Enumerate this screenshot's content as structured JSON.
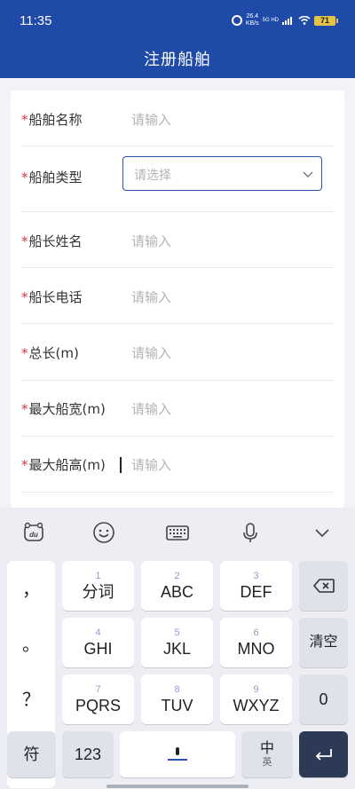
{
  "status_bar": {
    "time": "11:35",
    "speed_value": "26.4",
    "speed_unit": "KB/s",
    "network": "5G HD",
    "battery": "71"
  },
  "header": {
    "title": "注册船舶"
  },
  "form": {
    "required_mark": "*",
    "fields": [
      {
        "label": "船舶名称",
        "placeholder": "请输入"
      },
      {
        "label": "船舶类型",
        "placeholder": "请选择"
      },
      {
        "label": "船长姓名",
        "placeholder": "请输入"
      },
      {
        "label": "船长电话",
        "placeholder": "请输入"
      },
      {
        "label": "总长(m)",
        "placeholder": "请输入"
      },
      {
        "label": "最大船宽(m)",
        "placeholder": "请输入"
      },
      {
        "label": "最大船高(m)",
        "placeholder": "请输入"
      }
    ]
  },
  "keyboard": {
    "toolbar_icons": [
      "baidu-du-icon",
      "emoji-icon",
      "keyboard-icon",
      "microphone-icon",
      "chevron-down-icon"
    ],
    "punctuation": [
      "，",
      "。",
      "？",
      "！"
    ],
    "keys": [
      {
        "num": "1",
        "label": "分词"
      },
      {
        "num": "2",
        "label": "ABC"
      },
      {
        "num": "3",
        "label": "DEF"
      },
      {
        "num": "4",
        "label": "GHI"
      },
      {
        "num": "5",
        "label": "JKL"
      },
      {
        "num": "6",
        "label": "MNO"
      },
      {
        "num": "7",
        "label": "PQRS"
      },
      {
        "num": "8",
        "label": "TUV"
      },
      {
        "num": "9",
        "label": "WXYZ"
      }
    ],
    "clear_label": "清空",
    "zero_label": "0",
    "symbol_label": "符",
    "numeric_label": "123",
    "lang_main": "中",
    "lang_sub": "英"
  }
}
